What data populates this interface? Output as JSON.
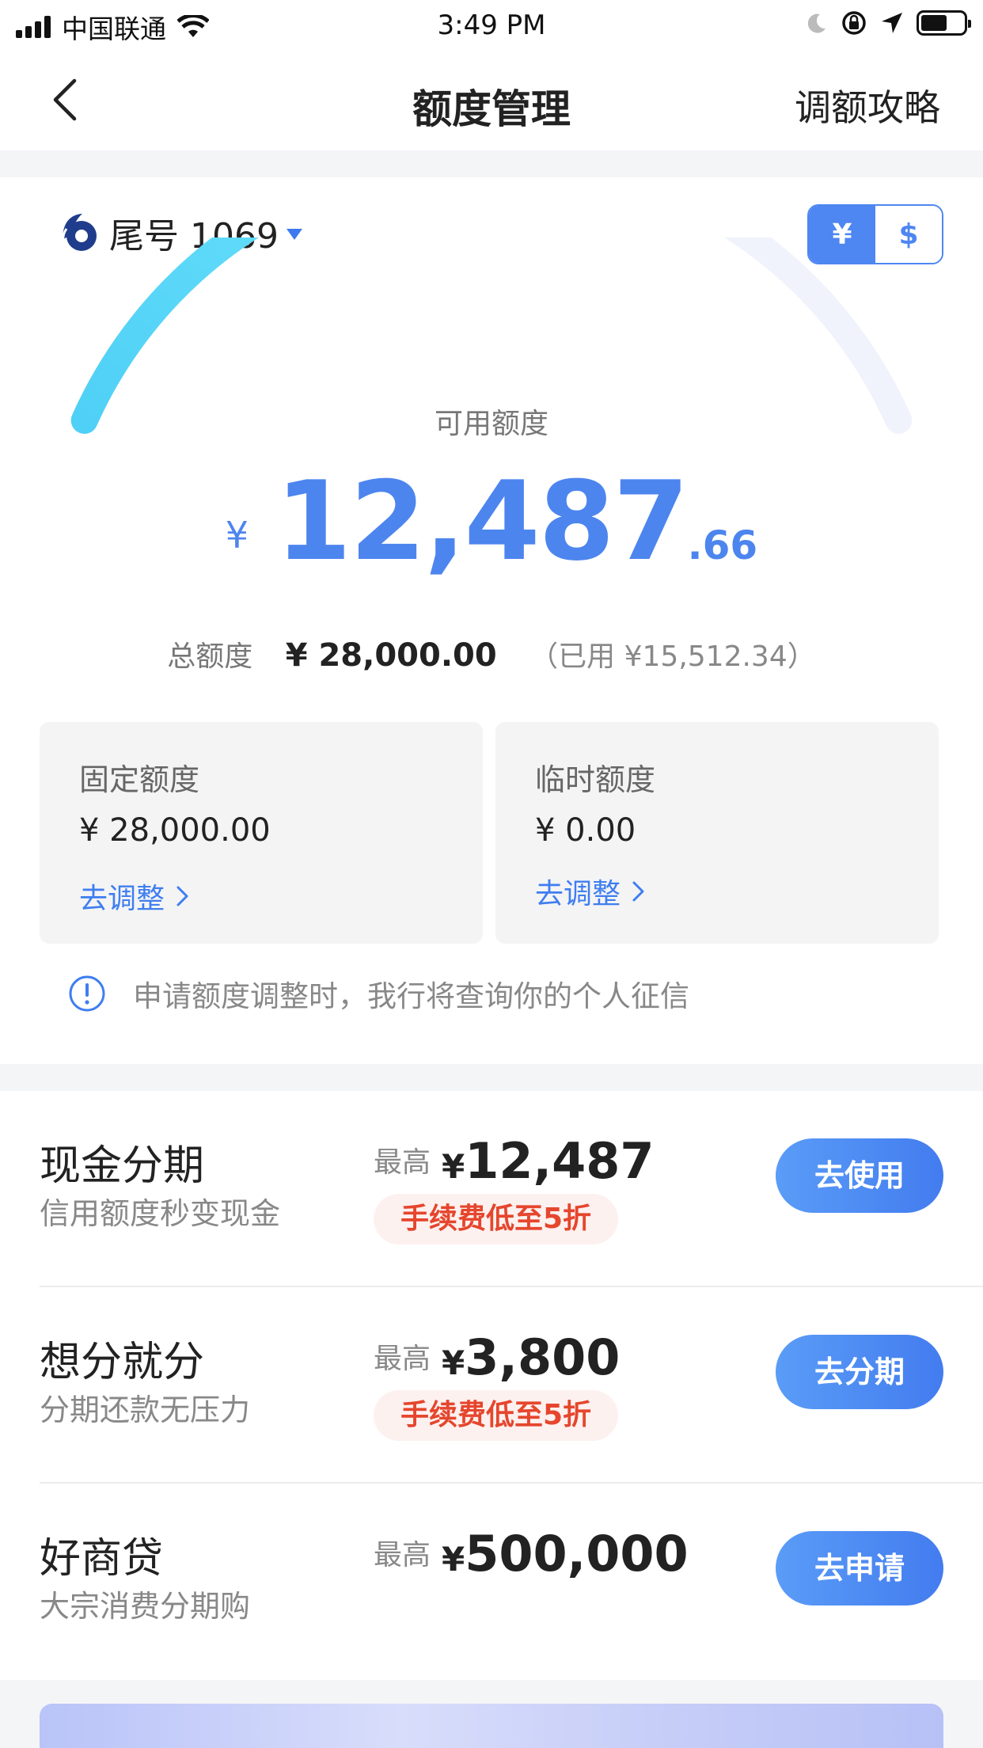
{
  "status_bar": {
    "carrier": "中国联通",
    "time": "3:49 PM"
  },
  "nav": {
    "title": "额度管理",
    "right_link": "调额攻略"
  },
  "card": {
    "label": "尾号 1069",
    "currency_options": [
      "¥",
      "$"
    ],
    "selected_currency": "¥"
  },
  "gauge": {
    "label": "可用额度",
    "symbol": "¥",
    "amount_int": "12,487",
    "amount_dec": ".66",
    "used_fraction": 0.554,
    "colors": {
      "track": "#f0f3fb",
      "fill_start": "#4fd0f6",
      "fill_end": "#6ae1fb"
    }
  },
  "total": {
    "label": "总额度",
    "value": "¥ 28,000.00",
    "used": "（已用 ¥15,512.34）"
  },
  "limits": [
    {
      "title": "固定额度",
      "value": "¥ 28,000.00",
      "link": "去调整"
    },
    {
      "title": "临时额度",
      "value": "¥ 0.00",
      "link": "去调整"
    }
  ],
  "notice": "申请额度调整时，我行将查询你的个人征信",
  "products": [
    {
      "name": "现金分期",
      "desc": "信用额度秒变现金",
      "max_label": "最高",
      "currency": "¥",
      "amount": "12,487",
      "tag": "手续费低至5折",
      "button": "去使用"
    },
    {
      "name": "想分就分",
      "desc": "分期还款无压力",
      "max_label": "最高",
      "currency": "¥",
      "amount": "3,800",
      "tag": "手续费低至5折",
      "button": "去分期"
    },
    {
      "name": "好商贷",
      "desc": "大宗消费分期购",
      "max_label": "最高",
      "currency": "¥",
      "amount": "500,000",
      "tag": "",
      "button": "去申请"
    }
  ]
}
